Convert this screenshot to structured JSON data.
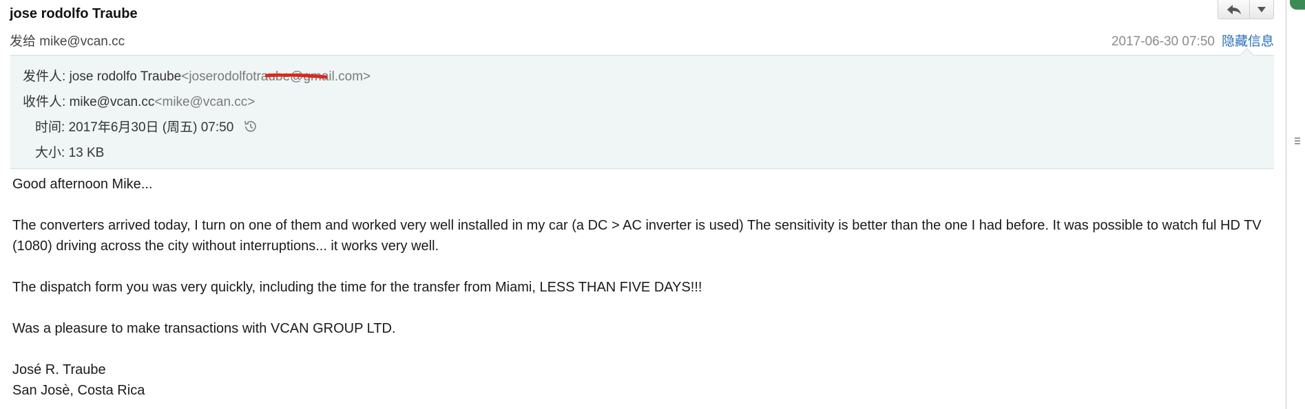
{
  "header": {
    "sender_name": "jose rodolfo Traube",
    "to_label": "发给",
    "to_value": "mike@vcan.cc",
    "datetime": "2017-06-30 07:50",
    "hide_details_label": "隐藏信息"
  },
  "details": {
    "from_label": "发件人:",
    "from_name": "jose rodolfo Traube",
    "from_email": "<joserodolfotraube@gmail.com>",
    "recipient_label": "收件人:",
    "recipient_name": "mike@vcan.cc",
    "recipient_email": "<mike@vcan.cc>",
    "time_label": "时间:",
    "time_value": "2017年6月30日 (周五) 07:50",
    "size_label": "大小:",
    "size_value": "13 KB"
  },
  "body": {
    "greeting": "Good afternoon Mike...",
    "para1": "The converters  arrived today, I turn on one of them and worked very well installed in my car (a DC > AC inverter is used) The sensitivity is better than the one I had before.  It was possible to watch ful HD TV (1080) driving across the city without interruptions... it works very well.",
    "para2": "The dispatch form you was very quickly, including the time for the transfer from Miami, LESS THAN FIVE DAYS!!!",
    "para3": "Was a pleasure to make transactions with VCAN GROUP LTD.",
    "signature_name": "José R. Traube",
    "signature_location": "San Josè, Costa Rica"
  },
  "icons": {
    "reply": "reply-icon",
    "more": "chevron-down-icon",
    "history": "history-icon"
  },
  "colors": {
    "link": "#2a6fb5",
    "header_bg": "#f0f5f5",
    "redaction": "#e0261c"
  }
}
